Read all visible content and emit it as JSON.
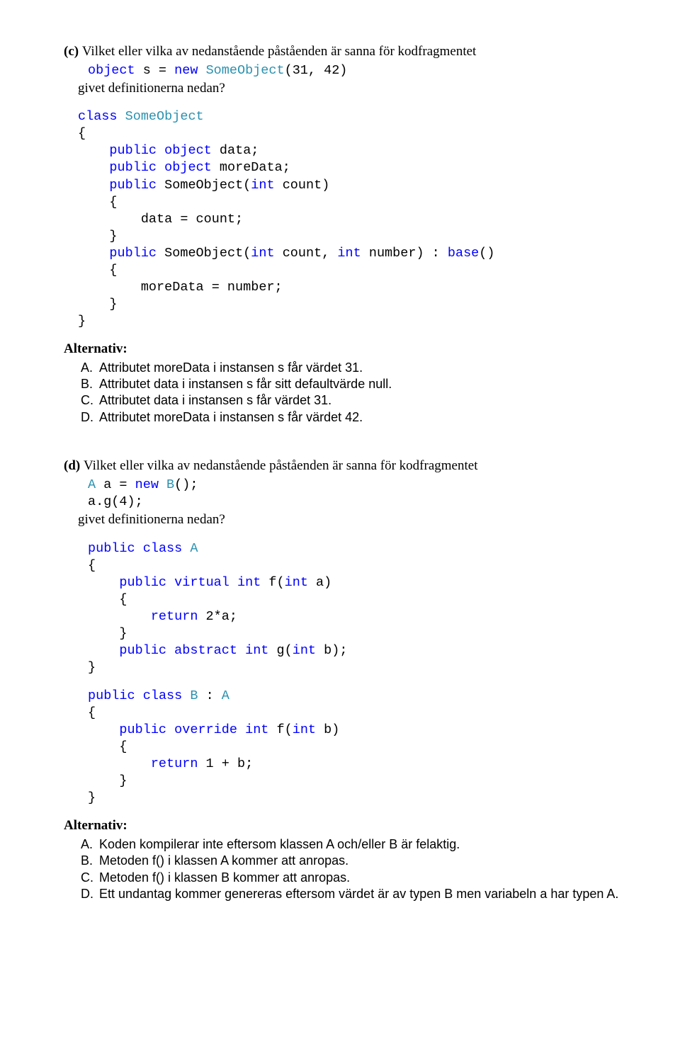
{
  "c": {
    "label": "(c) ",
    "intro": "Vilket eller vilka av nedanstående påståenden är sanna för kodfragmentet",
    "frag_line": "object s = new SomeObject(31, 42)",
    "given": "givet definitionerna nedan?",
    "code_plain": "class SomeObject\n{\n    public object data;\n    public object moreData;\n    public SomeObject(int count)\n    {\n        data = count;\n    }\n    public SomeObject(int count, int number) : base()\n    {\n        moreData = number;\n    }\n}",
    "alt_heading": "Alternativ:",
    "alts": [
      {
        "l": "A.",
        "t": "Attributet moreData i instansen s får värdet 31."
      },
      {
        "l": "B.",
        "t": "Attributet data i instansen s får sitt defaultvärde null."
      },
      {
        "l": "C.",
        "t": "Attributet data i instansen s får värdet 31."
      },
      {
        "l": "D.",
        "t": "Attributet moreData i instansen s får värdet 42."
      }
    ]
  },
  "d": {
    "label": "(d) ",
    "intro": "Vilket eller vilka av nedanstående påståenden är sanna för kodfragmentet",
    "frag_line1": "A a = new B();",
    "frag_line2": "a.g(4);",
    "given": "givet definitionerna nedan?",
    "code_plain_a": "public class A\n{\n    public virtual int f(int a)\n    {\n        return 2*a;\n    }\n    public abstract int g(int b);\n}",
    "code_plain_b": "public class B : A\n{\n    public override int f(int b)\n    {\n        return 1 + b;\n    }\n}",
    "alt_heading": "Alternativ:",
    "alts": [
      {
        "l": "A.",
        "t": "Koden kompilerar inte eftersom klassen A och/eller B är felaktig."
      },
      {
        "l": "B.",
        "t": "Metoden f() i klassen A kommer att anropas."
      },
      {
        "l": "C.",
        "t": "Metoden f() i klassen B kommer att anropas."
      },
      {
        "l": "D.",
        "t": "Ett undantag kommer genereras eftersom värdet är av typen B men variabeln a har typen A."
      }
    ]
  }
}
